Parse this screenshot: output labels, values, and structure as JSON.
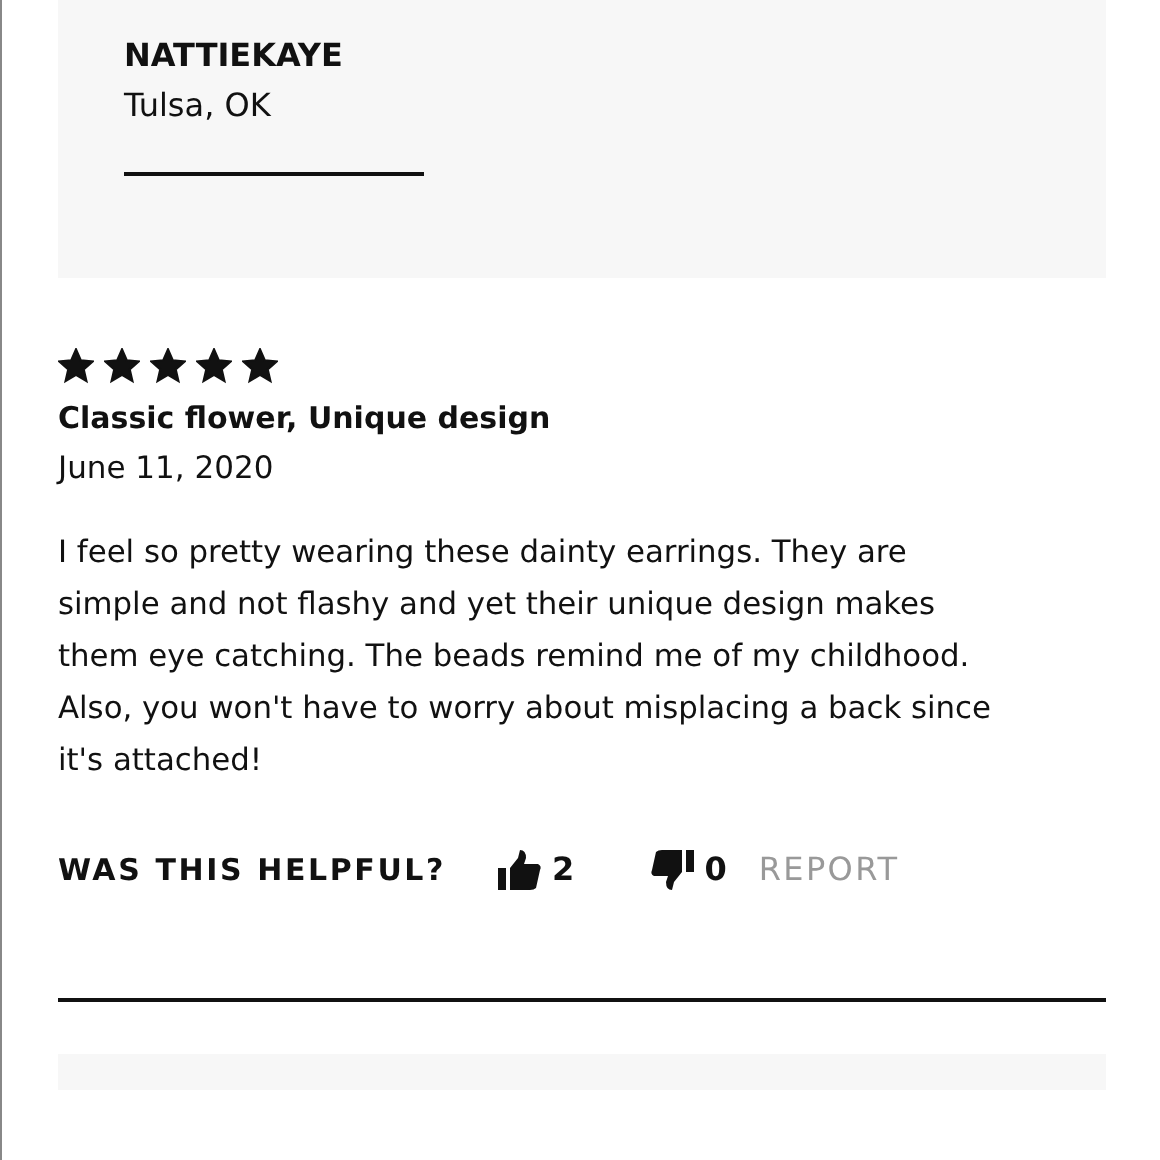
{
  "reviewer": {
    "name": "NATTIEKAYE",
    "location": "Tulsa, OK"
  },
  "review": {
    "stars": 5,
    "title": "Classic flower, Unique design",
    "date": "June 11, 2020",
    "body": "I feel so pretty wearing these dainty earrings. They are simple and not flashy and yet their unique design makes them eye catching. The beads remind me of my childhood. Also, you won't have to worry about misplacing a back since it's attached!"
  },
  "feedback": {
    "prompt": "WAS THIS HELPFUL?",
    "upvotes": "2",
    "downvotes": "0",
    "report": "REPORT"
  }
}
